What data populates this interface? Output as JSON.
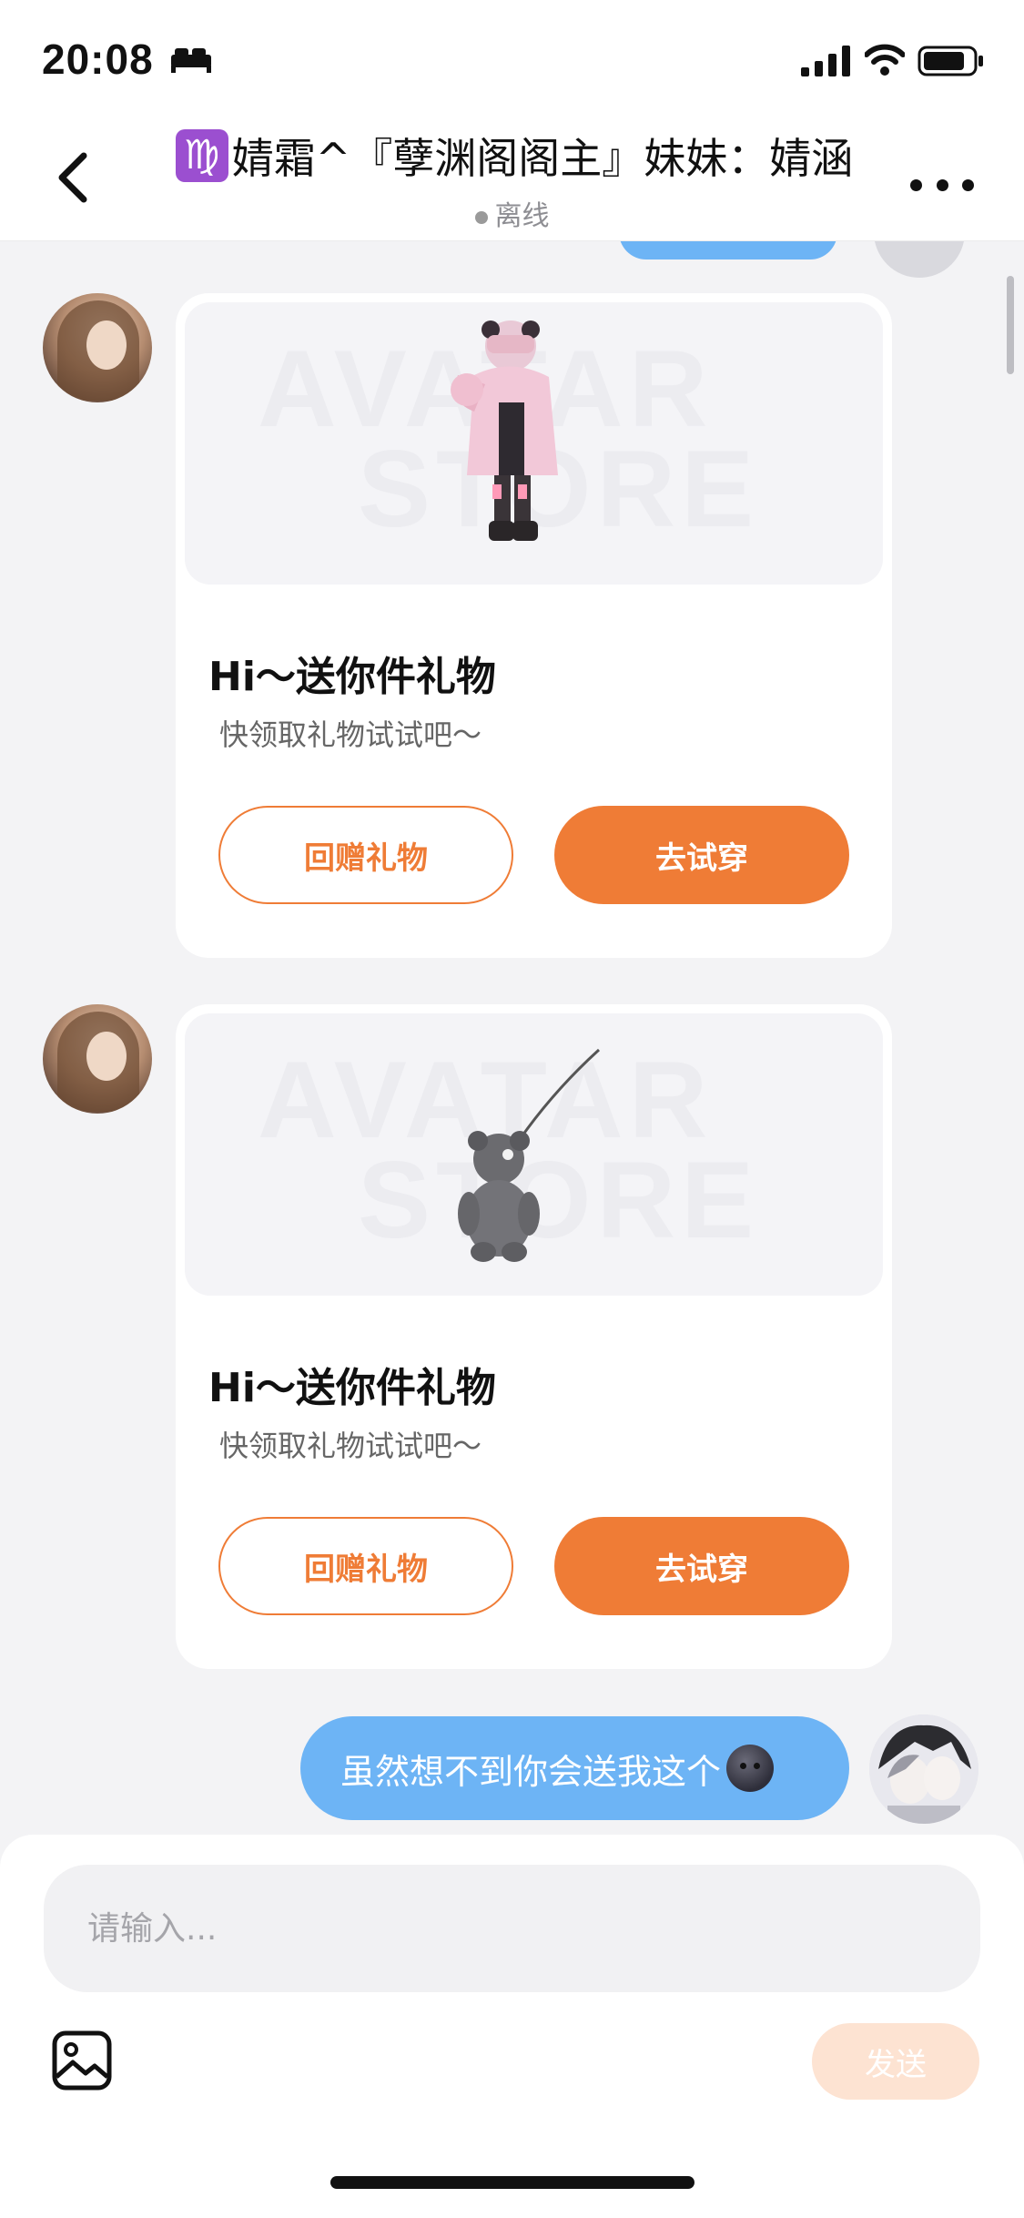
{
  "status_bar": {
    "time": "20:08",
    "icons": [
      "bed-icon",
      "signal-icon",
      "wifi-icon",
      "battery-icon"
    ]
  },
  "header": {
    "title": "婧霜^『孽渊阁阁主』妹妹：婧涵",
    "zodiac_icon": "♍",
    "presence": "离线",
    "back_icon": "chevron-left-icon",
    "more_icon": "more-dots-icon"
  },
  "messages": [
    {
      "type": "gift",
      "sender": "other",
      "title": "Hi～送你件礼物",
      "subtitle": "快领取礼物试试吧～",
      "watermark_line1": "AVATAR",
      "watermark_line2": "STORE",
      "return_gift_label": "回赠礼物",
      "try_on_label": "去试穿"
    },
    {
      "type": "gift",
      "sender": "other",
      "title": "Hi～送你件礼物",
      "subtitle": "快领取礼物试试吧～",
      "watermark_line1": "AVATAR",
      "watermark_line2": "STORE",
      "return_gift_label": "回赠礼物",
      "try_on_label": "去试穿"
    },
    {
      "type": "text",
      "sender": "me",
      "text": "虽然想不到你会送我这个"
    }
  ],
  "composer": {
    "placeholder": "请输入...",
    "send_label": "发送",
    "image_icon": "image-icon"
  },
  "colors": {
    "accent": "#ef7c36",
    "bubble": "#6db4f5",
    "background": "#f3f3f5"
  }
}
